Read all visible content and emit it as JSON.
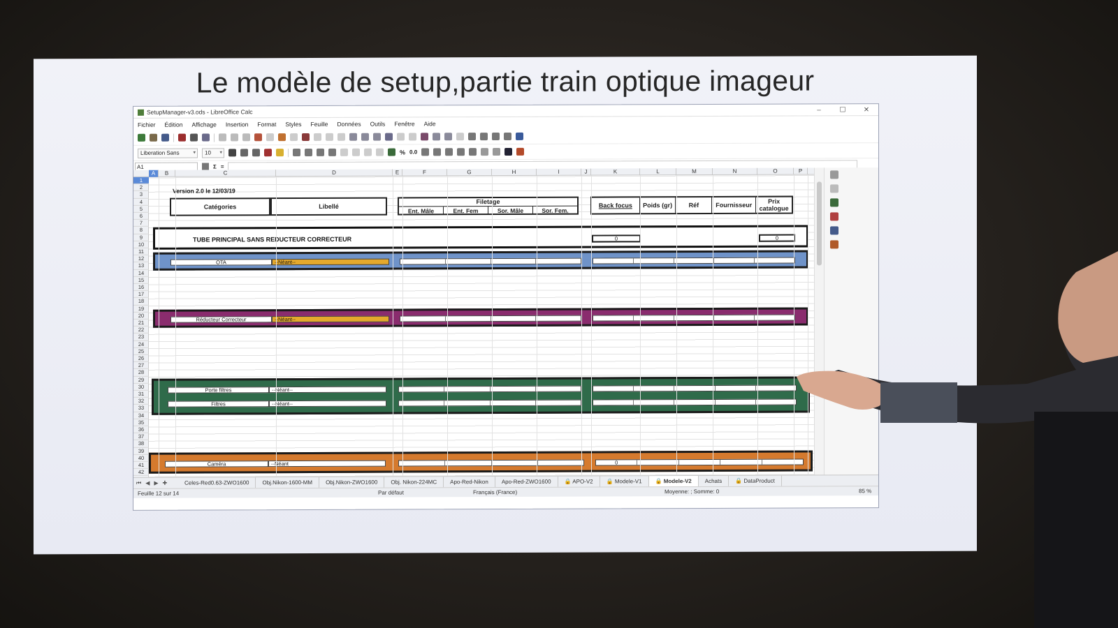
{
  "slide": {
    "title": "Le modèle de setup,partie train optique imageur"
  },
  "window": {
    "title": "SetupManager-v3.ods - LibreOffice Calc",
    "controls": [
      "–",
      "☐",
      "✕"
    ]
  },
  "menu": [
    "Fichier",
    "Édition",
    "Affichage",
    "Insertion",
    "Format",
    "Styles",
    "Feuille",
    "Données",
    "Outils",
    "Fenêtre",
    "Aide"
  ],
  "format_toolbar": {
    "font_name": "Liberation Sans",
    "font_size": "10",
    "percent": "%",
    "decimal": "0.0"
  },
  "formula_bar": {
    "cell_ref": "A1",
    "icons": [
      "function-wizard",
      "sum",
      "formula"
    ],
    "sigma": "Σ",
    "equals": "="
  },
  "columns": [
    "A",
    "B",
    "C",
    "D",
    "E",
    "F",
    "G",
    "H",
    "I",
    "J",
    "K",
    "L",
    "M",
    "N",
    "O",
    "P"
  ],
  "rows": [
    "1",
    "2",
    "3",
    "4",
    "5",
    "6",
    "7",
    "8",
    "9",
    "10",
    "11",
    "12",
    "13",
    "14",
    "15",
    "16",
    "17",
    "18",
    "19",
    "20",
    "21",
    "22",
    "23",
    "24",
    "25",
    "26",
    "27",
    "28",
    "29",
    "30",
    "31",
    "32",
    "33",
    "34",
    "35",
    "36",
    "37",
    "38",
    "39",
    "40",
    "41",
    "42"
  ],
  "sheet": {
    "version": "Version 2.0 le 12/03/19",
    "headers": {
      "categories": "Catégories",
      "libelle": "Libellé",
      "filetage": "Filetage",
      "ent_male": "Ent. Mâle",
      "ent_fem": "Ent. Fem",
      "sor_male": "Sor. Mâle",
      "sor_fem": "Sor. Fem.",
      "back_focus": "Back focus",
      "poids": "Poids (gr)",
      "ref": "Réf",
      "fournisseur": "Fournisseur",
      "prix": "Prix catalogue"
    },
    "tube_label": "TUBE PRINCIPAL SANS REDUCTEUR CORRECTEUR",
    "tube_backfocus": "0",
    "tube_prix": "0",
    "bands": [
      {
        "category": "OTA",
        "value": "--Néant--",
        "color": "#6f93c9"
      },
      {
        "category": "Réducteur Correcteur",
        "value": "--Néant--",
        "color": "#8a2c6e"
      },
      {
        "category": "Porte filtres",
        "value": "--Néant--",
        "color": "#2f6b4a"
      },
      {
        "category": "Filtres",
        "value": "--Néant--",
        "color": "#2f6b4a"
      },
      {
        "category": "Caméra",
        "value": "--Néant",
        "color": "#d57a2e"
      }
    ],
    "camera_backfocus": "0",
    "select_color": "#e5a92c"
  },
  "sheet_tabs": [
    "Celes-Red0.63-ZWO1600",
    "Obj.Nikon-1600-MM",
    "Obj.Nikon-ZWO1600",
    "Obj. Nikon-224MC",
    "Apo-Red-Nikon",
    "Apo-Red-ZWO1600",
    "APO-V2",
    "Modele-V1",
    "Modele-V2",
    "Achats",
    "DataProduct"
  ],
  "active_tab": "Modele-V2",
  "status": {
    "sheet": "Feuille 12 sur 14",
    "style": "Par défaut",
    "lang": "Français (France)",
    "sum": "Moyenne: ; Somme: 0",
    "zoom": "85 %"
  },
  "colors": {
    "accent": "#4f7d3a"
  }
}
